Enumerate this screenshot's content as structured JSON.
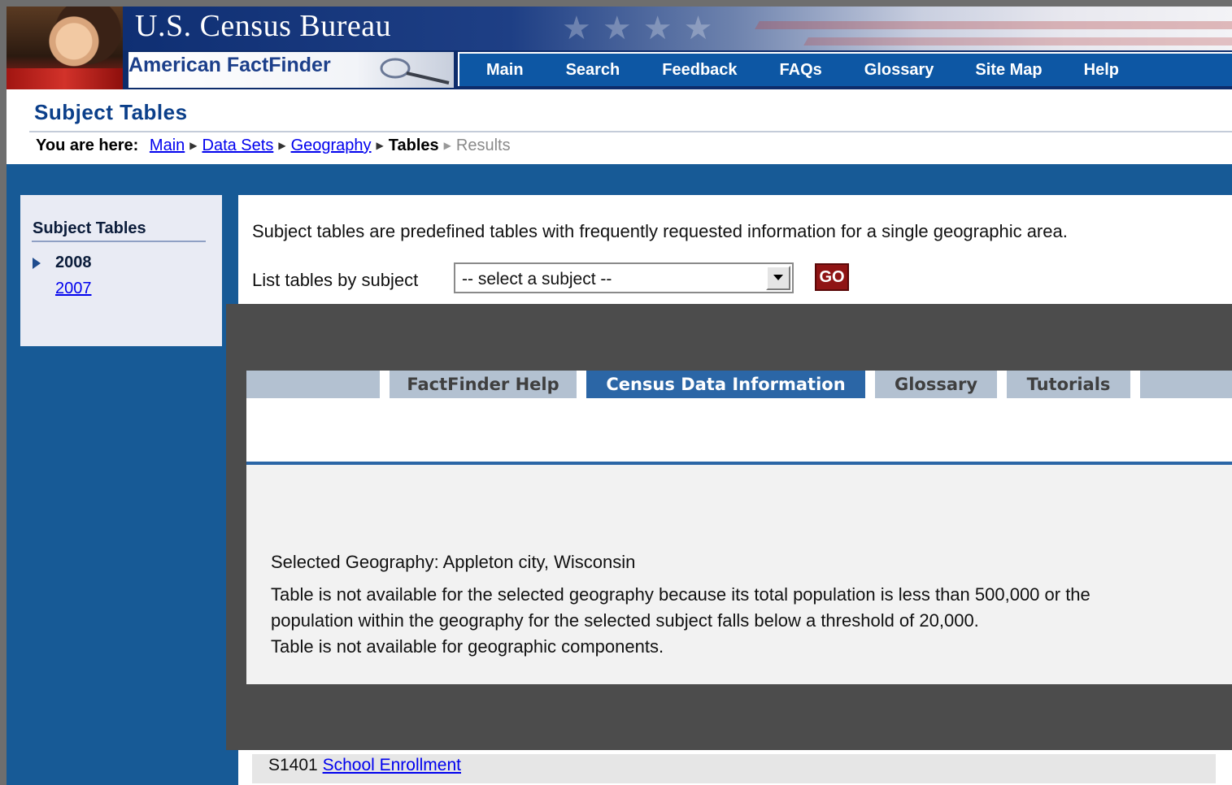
{
  "header": {
    "title": "U.S. Census Bureau",
    "product": "American FactFinder",
    "nav": [
      "Main",
      "Search",
      "Feedback",
      "FAQs",
      "Glossary",
      "Site Map",
      "Help"
    ]
  },
  "page": {
    "title": "Subject Tables",
    "breadcrumb": {
      "label": "You are here:",
      "links": [
        "Main",
        "Data Sets",
        "Geography"
      ],
      "current": "Tables",
      "next": "Results"
    }
  },
  "sidebar": {
    "heading": "Subject Tables",
    "items": [
      {
        "label": "2008",
        "selected": true
      },
      {
        "label": "2007",
        "selected": false
      }
    ]
  },
  "main": {
    "intro": "Subject tables are predefined tables with frequently requested information for a single geographic area.",
    "list_label": "List tables by subject",
    "select_value": "-- select a subject --",
    "go_label": "GO",
    "result": {
      "code": "S1401",
      "link": "School Enrollment"
    }
  },
  "dialog": {
    "tabs": [
      {
        "label": "FactFinder Help",
        "active": false
      },
      {
        "label": "Census Data Information",
        "active": true
      },
      {
        "label": "Glossary",
        "active": false
      },
      {
        "label": "Tutorials",
        "active": false
      }
    ],
    "geography": "Selected Geography: Appleton city, Wisconsin",
    "message_lines": [
      "Table is not available for the selected geography because its total population is less than 500,000 or the",
      "population within the geography for the selected subject falls below a threshold of 20,000.",
      "Table is not available for geographic components."
    ]
  },
  "colors": {
    "brand_navy": "#0d2c6b",
    "nav_blue": "#0d57a4",
    "page_blue": "#175a96",
    "overlay_gray": "#4c4c4c",
    "active_tab": "#2b66a6",
    "go_red": "#8f1414"
  }
}
